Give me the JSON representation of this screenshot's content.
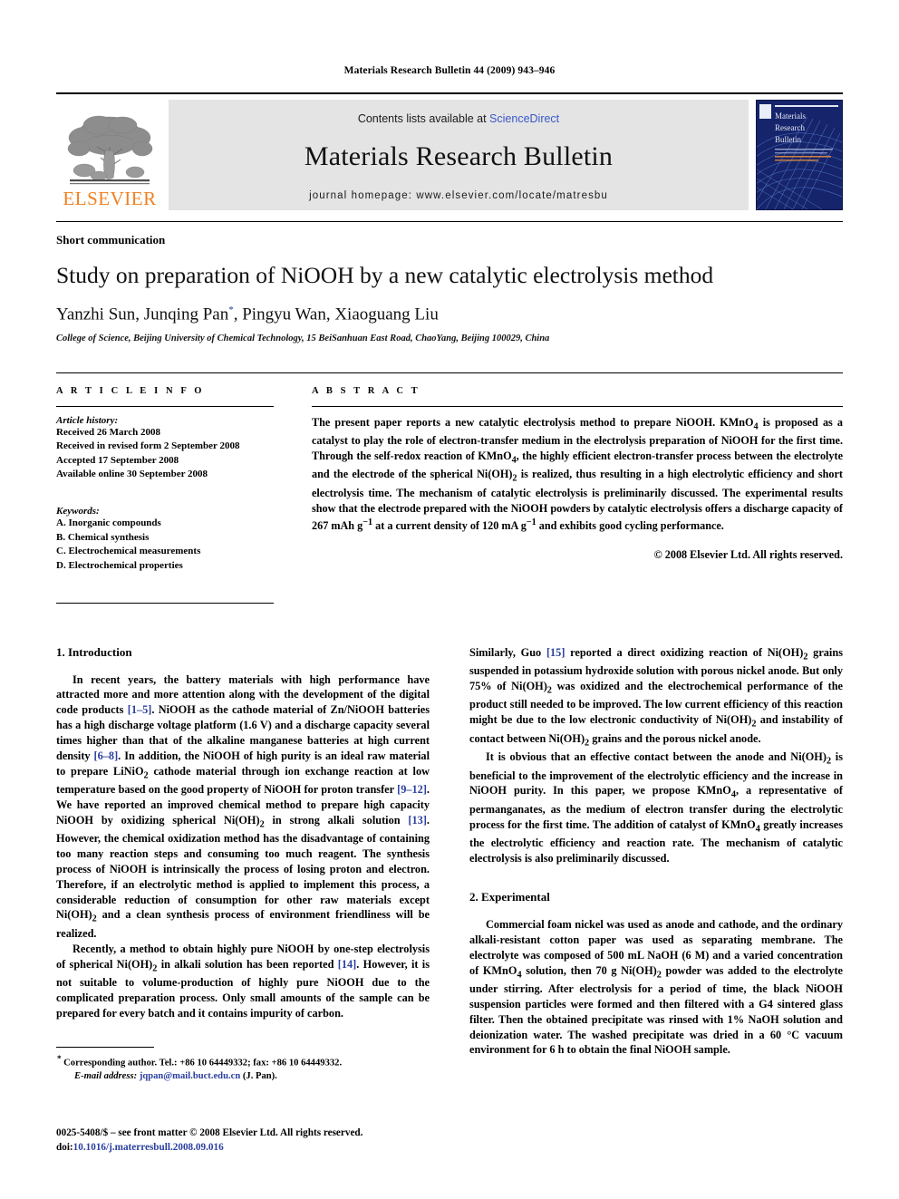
{
  "running_head": "Materials Research Bulletin 44 (2009) 943–946",
  "banner": {
    "publisher_name": "ELSEVIER",
    "contents_prefix": "Contents lists available at ",
    "sciencedirect": "ScienceDirect",
    "journal_title": "Materials Research Bulletin",
    "homepage": "journal homepage: www.elsevier.com/locate/matresbu",
    "cover_title_line1": "Materials",
    "cover_title_line2": "Research",
    "cover_title_line3": "Bulletin",
    "accent_orange": "#f08020",
    "link_blue": "#3a58c8",
    "panel_gray": "#e4e4e4",
    "cover_blue": "#16246b"
  },
  "article": {
    "type_label": "Short communication",
    "title": "Study on preparation of NiOOH by a new catalytic electrolysis method",
    "authors": "Yanzhi Sun, Junqing Pan",
    "corresponding_marker": "*",
    "authors_rest": ", Pingyu Wan, Xiaoguang Liu",
    "affiliation": "College of Science, Beijing University of Chemical Technology, 15 BeiSanhuan East Road, ChaoYang, Beijing 100029, China"
  },
  "article_info": {
    "section_label": "A R T I C L E   I N F O",
    "history_label": "Article history:",
    "history": [
      "Received 26 March 2008",
      "Received in revised form 2 September 2008",
      "Accepted 17 September 2008",
      "Available online 30 September 2008"
    ],
    "keywords_label": "Keywords:",
    "keywords": [
      "A. Inorganic compounds",
      "B. Chemical synthesis",
      "C. Electrochemical measurements",
      "D. Electrochemical properties"
    ]
  },
  "abstract": {
    "section_label": "A B S T R A C T",
    "text": "The present paper reports a new catalytic electrolysis method to prepare NiOOH. KMnO4 is proposed as a catalyst to play the role of electron-transfer medium in the electrolysis preparation of NiOOH for the first time. Through the self-redox reaction of KMnO4, the highly efficient electron-transfer process between the electrolyte and the electrode of the spherical Ni(OH)2 is realized, thus resulting in a high electrolytic efficiency and short electrolysis time. The mechanism of catalytic electrolysis is preliminarily discussed. The experimental results show that the electrode prepared with the NiOOH powders by catalytic electrolysis offers a discharge capacity of 267 mAh g−1 at a current density of 120 mA g−1 and exhibits good cycling performance.",
    "copyright": "© 2008 Elsevier Ltd. All rights reserved."
  },
  "sections": {
    "intro_title": "1. Introduction",
    "intro_p1_a": "In recent years, the battery materials with high performance have attracted more and more attention along with the development of the digital code products ",
    "intro_p1_ref1": "[1–5]",
    "intro_p1_b": ". NiOOH as the cathode material of Zn/NiOOH batteries has a high discharge voltage platform (1.6 V) and a discharge capacity several times higher than that of the alkaline manganese batteries at high current density ",
    "intro_p1_ref2": "[6–8]",
    "intro_p1_c": ". In addition, the NiOOH of high purity is an ideal raw material to prepare LiNiO2 cathode material through ion exchange reaction at low temperature based on the good property of NiOOH for proton transfer ",
    "intro_p1_ref3": "[9–12]",
    "intro_p1_d": ". We have reported an improved chemical method to prepare high capacity NiOOH by oxidizing spherical Ni(OH)2 in strong alkali solution ",
    "intro_p1_ref4": "[13]",
    "intro_p1_e": ". However, the chemical oxidization method has the disadvantage of containing too many reaction steps and consuming too much reagent. The synthesis process of NiOOH is intrinsically the process of losing proton and electron. Therefore, if an electrolytic method is applied to implement this process, a considerable reduction of consumption for other raw materials except Ni(OH)2 and a clean synthesis process of environment friendliness will be realized.",
    "intro_p2_a": "Recently, a method to obtain highly pure NiOOH by one-step electrolysis of spherical Ni(OH)2 in alkali solution has been reported ",
    "intro_p2_ref1": "[14]",
    "intro_p2_b": ". However, it is not suitable to volume-production of highly pure NiOOH due to the complicated preparation process. Only small amounts of the sample can be prepared for every batch and it contains impurity of carbon. Similarly, Guo ",
    "intro_p2_ref2": "[15]",
    "intro_p2_c": " reported a direct oxidizing reaction of Ni(OH)2 grains suspended in potassium hydroxide solution with porous nickel anode. But only 75% of Ni(OH)2 was oxidized and the electrochemical performance of the product still needed to be improved. The low current efficiency of this reaction might be due to the low electronic conductivity of Ni(OH)2 and instability of contact between Ni(OH)2 grains and the porous nickel anode.",
    "intro_p3": "It is obvious that an effective contact between the anode and Ni(OH)2 is beneficial to the improvement of the electrolytic efficiency and the increase in NiOOH purity. In this paper, we propose KMnO4, a representative of permanganates, as the medium of electron transfer during the electrolytic process for the first time. The addition of catalyst of KMnO4 greatly increases the electrolytic efficiency and reaction rate. The mechanism of catalytic electrolysis is also preliminarily discussed.",
    "exp_title": "2. Experimental",
    "exp_p1": "Commercial foam nickel was used as anode and cathode, and the ordinary alkali-resistant cotton paper was used as separating membrane. The electrolyte was composed of 500 mL NaOH (6 M) and a varied concentration of KMnO4 solution, then 70 g Ni(OH)2 powder was added to the electrolyte under stirring. After electrolysis for a period of time, the black NiOOH suspension particles were formed and then filtered with a G4 sintered glass filter. Then the obtained precipitate was rinsed with 1% NaOH solution and deionization water. The washed precipitate was dried in a 60 °C vacuum environment for 6 h to obtain the final NiOOH sample."
  },
  "footnote": {
    "corresponding": "Corresponding author. Tel.: +86 10 64449332; fax: +86 10 64449332.",
    "email_label": "E-mail address:",
    "email": "jqpan@mail.buct.edu.cn",
    "email_suffix": "(J. Pan)."
  },
  "footer": {
    "issn_line": "0025-5408/$ – see front matter © 2008 Elsevier Ltd. All rights reserved.",
    "doi_prefix": "doi:",
    "doi": "10.1016/j.materresbull.2008.09.016"
  }
}
